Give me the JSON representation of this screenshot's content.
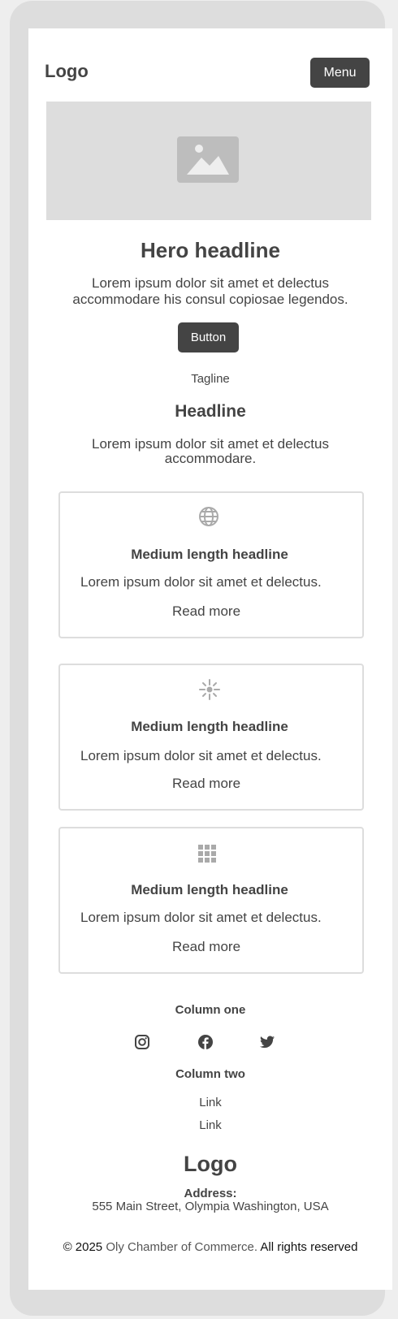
{
  "header": {
    "logo": "Logo",
    "menu_label": "Menu"
  },
  "hero": {
    "headline": "Hero headline",
    "text": "Lorem ipsum dolor sit amet et delectus accommodare his consul copiosae legendos.",
    "button_label": "Button"
  },
  "section": {
    "tagline": "Tagline",
    "headline": "Headline",
    "text": "Lorem ipsum dolor sit amet et delectus accommodare."
  },
  "cards": [
    {
      "icon": "globe-icon",
      "title": "Medium length headline",
      "text": "Lorem ipsum dolor sit amet et delectus.",
      "link": "Read more"
    },
    {
      "icon": "sparkle-icon",
      "title": "Medium length headline",
      "text": "Lorem ipsum dolor sit amet et delectus.",
      "link": "Read more"
    },
    {
      "icon": "grid-icon",
      "title": "Medium length headline",
      "text": "Lorem ipsum dolor sit amet et delectus.",
      "link": "Read more"
    }
  ],
  "footer": {
    "column_one": "Column one",
    "social_icons": [
      "instagram-icon",
      "facebook-icon",
      "twitter-icon"
    ],
    "column_two": "Column two",
    "links": [
      "Link",
      "Link"
    ],
    "logo": "Logo",
    "address_label": "Address:",
    "address": "555 Main Street, Olympia Washington, USA",
    "copyright_prefix": "© 2025",
    "organization": "Oly Chamber of Commerce.",
    "rights": "All rights reserved"
  },
  "colors": {
    "dark": "#444444",
    "placeholder": "#dddddd",
    "icon": "#aaaaaa"
  }
}
